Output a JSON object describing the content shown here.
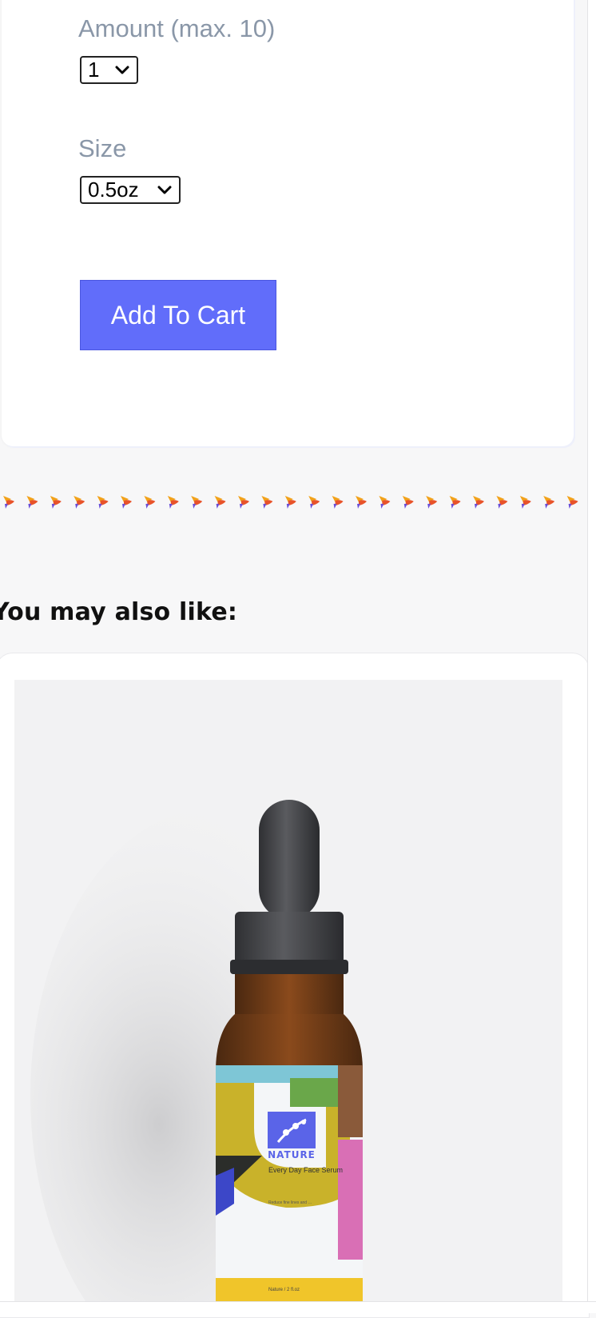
{
  "product": {
    "amount_label": "Amount (max. 10)",
    "amount_value": "1",
    "size_label": "Size",
    "size_value": "0.5oz",
    "add_to_cart": "Add To Cart"
  },
  "divider": {
    "icon": "hummingbird-icon",
    "count": 25
  },
  "recommendations": {
    "title": "You may also like:",
    "items": [
      {
        "image": "face-serum-bottle",
        "label_brand": "NATURE",
        "label_name": "Every Day Face Serum",
        "label_desc": "Reduce fine lines and wrinkles, balance and control oil, and even skin pigmentation with our flash absorbing hydro serum.",
        "label_volume": "Nature / 2 fl.oz"
      }
    ]
  },
  "colors": {
    "accent": "#616dfa",
    "label_grey": "#8a97a8",
    "page_bg": "#f7f7f8"
  }
}
